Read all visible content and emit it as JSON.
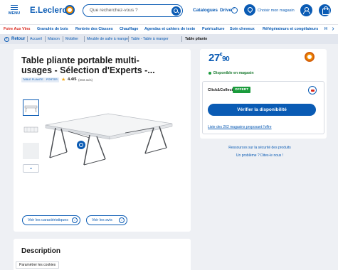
{
  "header": {
    "menu_label": "MENU",
    "logo_text": "E.Leclerc",
    "search_placeholder": "Que recherchez-vous ?",
    "catalogues": "Catalogues",
    "drive": "Drive",
    "store_label": "Choisir mon magasin"
  },
  "categories": [
    "Foire Aux Vins",
    "Granulés de bois",
    "Rentrée des Classes",
    "Chauffage",
    "Agendas et cahiers de texte",
    "Puériculture",
    "Soin cheveux",
    "Réfrigérateurs et congélateurs",
    "H"
  ],
  "breadcrumb": {
    "back": "Retour",
    "items": [
      "Accueil",
      "Maison",
      "Mobilier",
      "Meuble de salle à manger",
      "Table - Table à manger"
    ],
    "current": "Table pliante"
  },
  "product": {
    "title": "Table pliante portable multi-usages - Sélection d'Experts -...",
    "tags": [
      "TABLE PLIANTE",
      "PORTER"
    ],
    "rating": "4.4/5",
    "rating_count": "(263 avis)",
    "btn_features": "Voir les caractéristiques",
    "btn_reviews": "Voir les avis"
  },
  "description_title": "Description",
  "cookie_label": "Paramétrer les cookies",
  "buy": {
    "price_int": "27",
    "price_sup": "€",
    "price_cents": "90",
    "availability": "Disponible en magasin",
    "click_collect": "Click&Collect",
    "offert": "OFFERT",
    "verify_button": "Vérifier la disponibilité",
    "stores_link": "Liste des 262 magasins proposant l'offre",
    "safety_link": "Ressources sur la sécurité des produits",
    "problem_link": "Un problème ? Dites-le nous !"
  },
  "colors": {
    "brand_blue": "#0a5bb4",
    "brand_orange": "#f28c00",
    "available_green": "#1a9b3c"
  }
}
